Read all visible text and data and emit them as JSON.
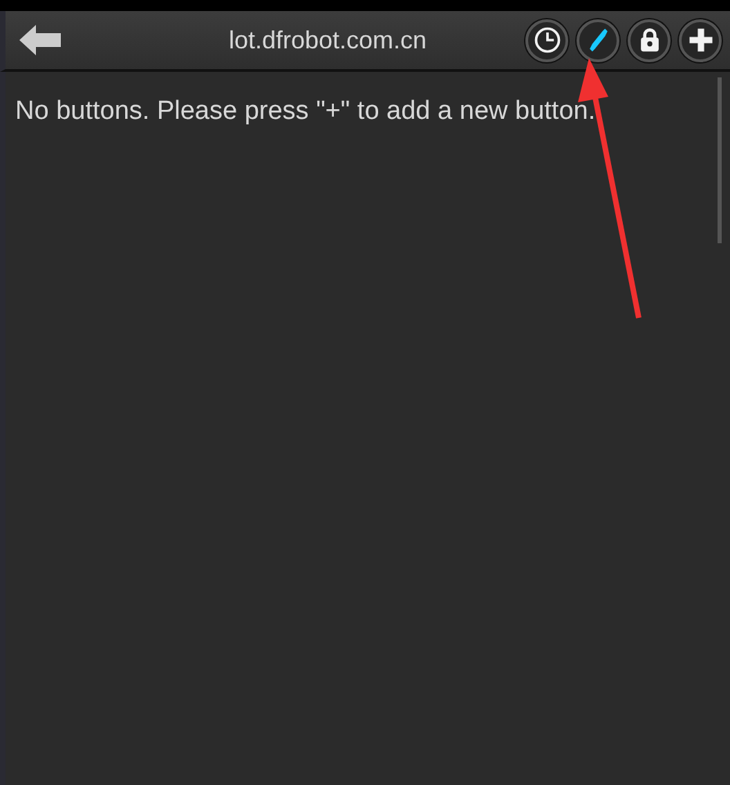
{
  "toolbar": {
    "title": "lot.dfrobot.com.cn",
    "buttons": [
      {
        "kind": "timer",
        "on": false
      },
      {
        "kind": "connection",
        "on": true
      },
      {
        "kind": "lock",
        "on": false
      },
      {
        "kind": "add",
        "on": false
      }
    ]
  },
  "message": "No buttons. Please press \"+\" to add a new button.",
  "annotation": {
    "kind": "arrow"
  }
}
